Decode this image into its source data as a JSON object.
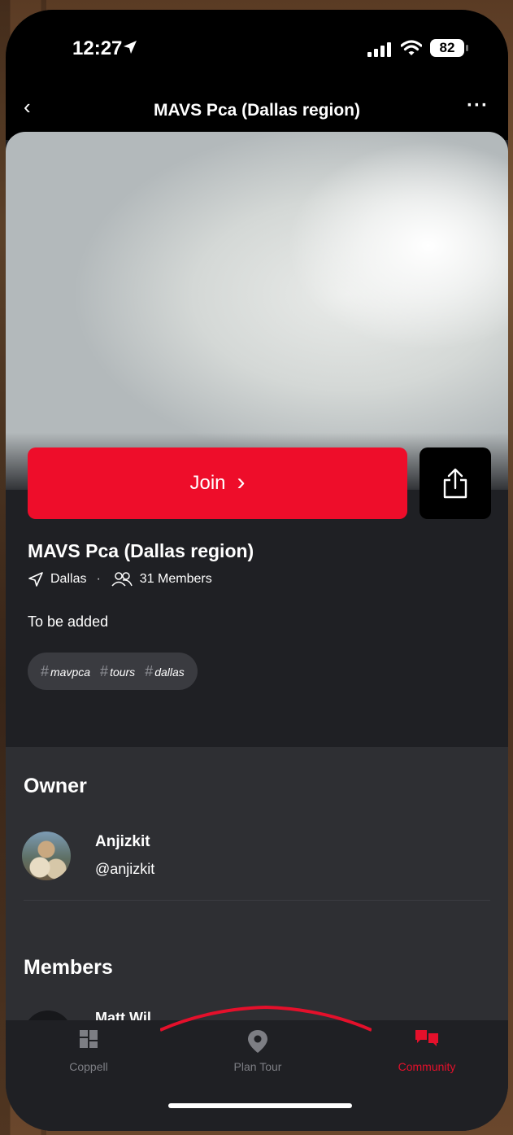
{
  "status_bar": {
    "time": "12:27",
    "battery": "82"
  },
  "nav": {
    "back_icon": "chevron-left-icon",
    "back_glyph": "‹",
    "title": "MAVS Pca (Dallas region)",
    "more_glyph": "···"
  },
  "group": {
    "join_label": "Join",
    "join_chevron": "›",
    "name": "MAVS Pca (Dallas region)",
    "location": "Dallas",
    "separator": "·",
    "members_count": "31 Members",
    "description": "To be added",
    "tags": [
      "mavpca",
      "tours",
      "dallas"
    ]
  },
  "owner": {
    "section_title": "Owner",
    "name": "Anjizkit",
    "handle": "@anjizkit"
  },
  "members": {
    "section_title": "Members",
    "first_member_partial": "Matt Wil"
  },
  "tabs": [
    {
      "label": "Coppell",
      "icon": "dashboard-icon",
      "active": false
    },
    {
      "label": "Plan Tour",
      "icon": "map-pin-icon",
      "active": false
    },
    {
      "label": "Community",
      "icon": "chat-bubbles-icon",
      "active": true
    }
  ],
  "colors": {
    "accent": "#ee0d2a",
    "background": "#1f2024",
    "section_bg": "#2e2f33"
  }
}
